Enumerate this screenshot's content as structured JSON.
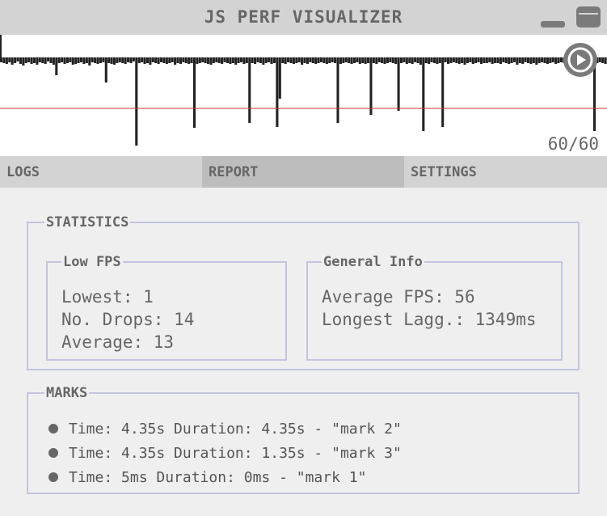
{
  "window": {
    "title": "JS PERF VISUALIZER"
  },
  "graph": {
    "fps_display": "60/60",
    "frame_times": [
      15,
      16,
      17,
      15,
      18,
      16,
      14,
      17,
      19,
      16,
      15,
      17,
      16,
      18,
      15,
      16,
      17,
      14,
      16,
      18,
      31,
      16,
      15,
      17,
      16,
      15,
      18,
      17,
      16,
      15,
      17,
      16,
      19,
      15,
      16,
      17,
      16,
      15,
      40,
      16,
      17,
      18,
      16,
      15,
      16,
      17,
      15,
      16,
      14,
      118,
      16,
      15,
      17,
      16,
      18,
      15,
      16,
      17,
      15,
      16,
      17,
      16,
      15,
      18,
      16,
      17,
      15,
      16,
      17,
      16,
      96,
      17,
      16,
      15,
      16,
      17,
      18,
      16,
      15,
      16,
      17,
      15,
      16,
      17,
      16,
      18,
      16,
      15,
      17,
      16,
      90,
      16,
      17,
      15,
      16,
      18,
      16,
      15,
      17,
      16,
      95,
      60,
      16,
      17,
      15,
      16,
      17,
      16,
      15,
      18,
      16,
      17,
      15,
      16,
      17,
      16,
      15,
      16,
      17,
      16,
      15,
      16,
      90,
      17,
      16,
      15,
      16,
      17,
      16,
      15,
      17,
      16,
      17,
      16,
      80,
      16,
      17,
      15,
      16,
      17,
      16,
      15,
      16,
      17,
      75,
      16,
      15,
      17,
      16,
      17,
      15,
      16,
      18,
      100,
      16,
      17,
      15,
      16,
      17,
      16,
      95,
      15,
      17,
      16,
      15,
      16,
      17,
      16,
      18,
      16,
      15,
      17,
      16,
      15,
      17,
      16,
      16,
      15,
      17,
      16,
      16,
      17,
      15,
      16,
      17,
      16,
      15,
      18,
      16,
      17,
      15,
      16,
      17,
      16,
      18,
      16,
      15,
      16,
      17,
      16,
      15,
      17,
      16,
      15,
      16,
      17,
      16,
      15,
      18,
      16,
      17,
      15,
      16,
      17,
      16,
      100,
      16,
      15,
      16,
      17
    ],
    "fps_threshold_ms": 48
  },
  "tabs": [
    {
      "label": "LOGS",
      "active": false
    },
    {
      "label": "REPORT",
      "active": true
    },
    {
      "label": "SETTINGS",
      "active": false
    }
  ],
  "statistics": {
    "legend": "STATISTICS",
    "low_fps": {
      "legend": "Low FPS",
      "lowest": "Lowest: 1",
      "drops": "No. Drops: 14",
      "average": "Average: 13"
    },
    "general": {
      "legend": "General Info",
      "avg_fps": "Average FPS: 56",
      "longest_lag": "Longest Lagg.: 1349ms"
    }
  },
  "marks": {
    "legend": "MARKS",
    "items": [
      "Time: 4.35s Duration: 4.35s - \"mark 2\"",
      "Time: 4.35s Duration: 1.35s - \"mark 3\"",
      "Time: 5ms Duration: 0ms - \"mark 1\""
    ]
  }
}
